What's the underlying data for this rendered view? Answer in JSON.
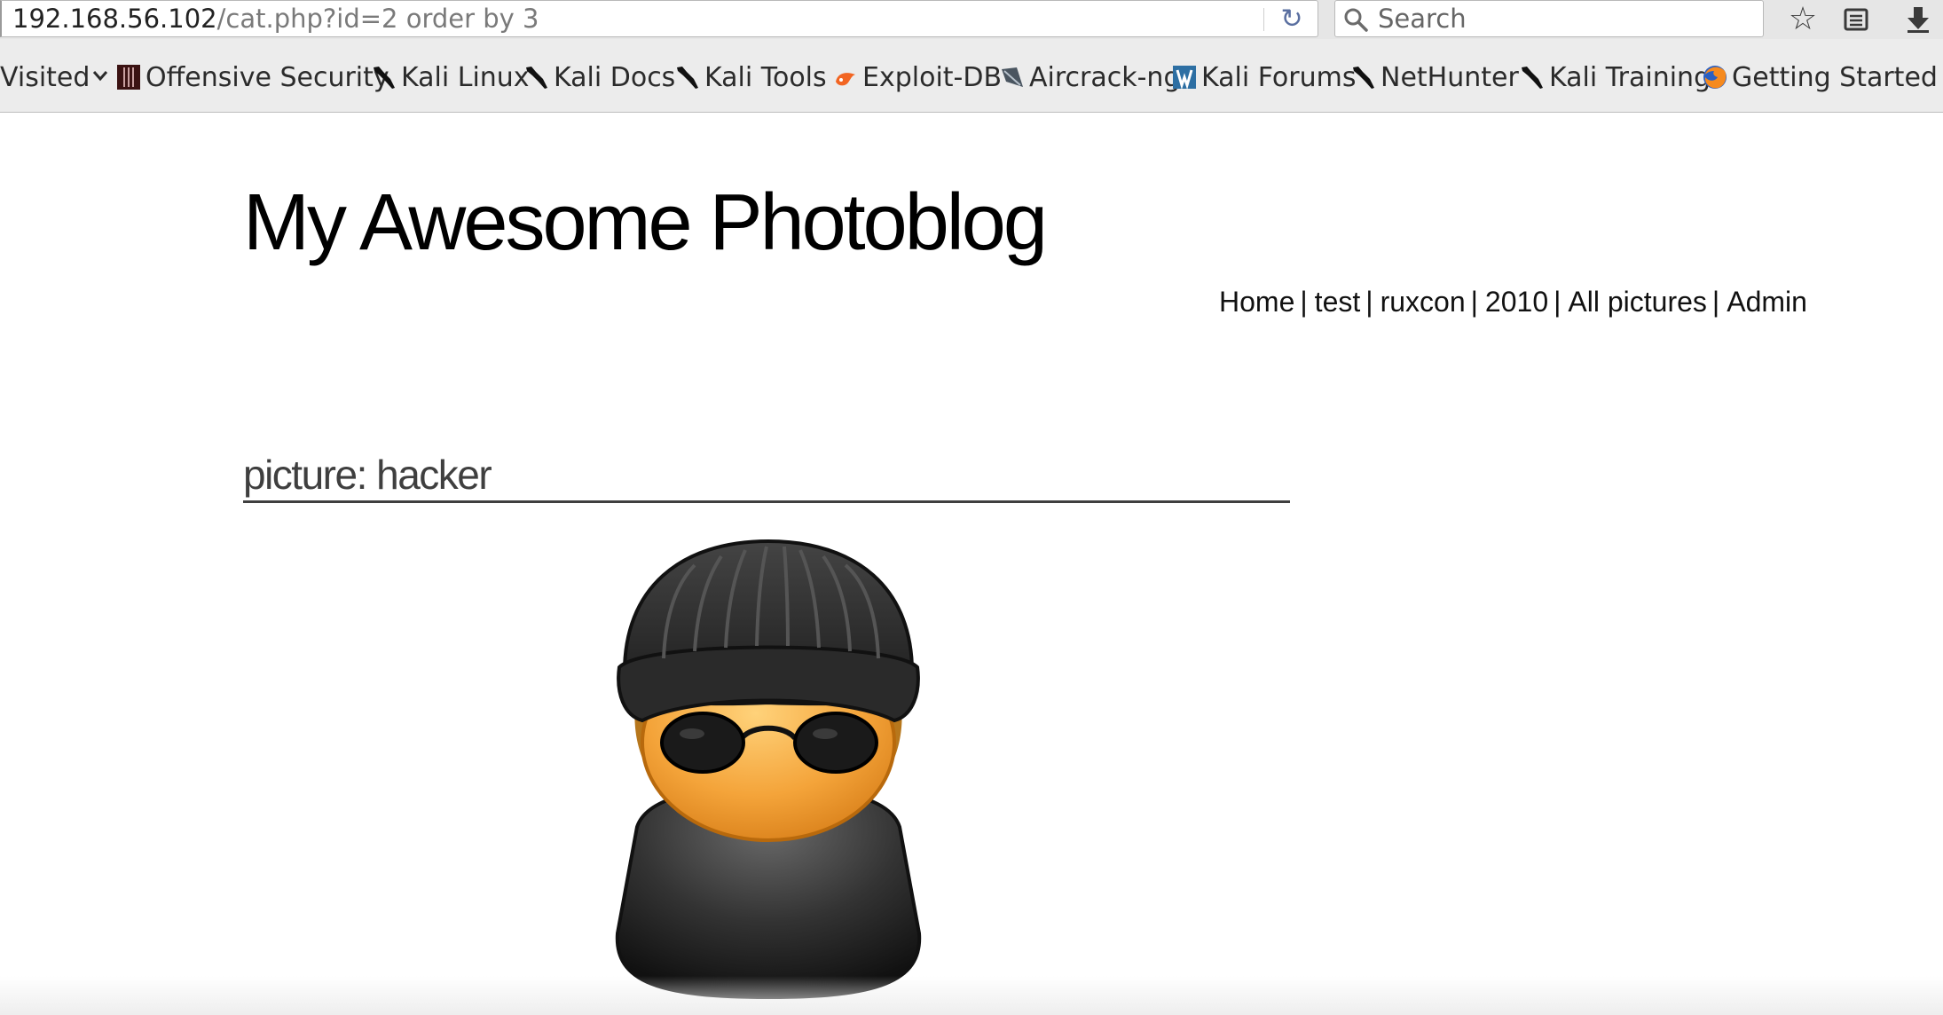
{
  "browser": {
    "url_host": "192.168.56.102",
    "url_path": "/cat.php?id=2 order by 3",
    "search_placeholder": "Search",
    "bookmarks": [
      {
        "label": "Visited",
        "icon": "chevron-down-icon"
      },
      {
        "label": "Offensive Security",
        "icon": "offsec-icon"
      },
      {
        "label": "Kali Linux",
        "icon": "kali-dragon-icon"
      },
      {
        "label": "Kali Docs",
        "icon": "kali-dragon-icon"
      },
      {
        "label": "Kali Tools",
        "icon": "kali-dragon-icon"
      },
      {
        "label": "Exploit-DB",
        "icon": "exploit-db-icon"
      },
      {
        "label": "Aircrack-ng",
        "icon": "aircrack-icon"
      },
      {
        "label": "Kali Forums",
        "icon": "kali-forums-icon"
      },
      {
        "label": "NetHunter",
        "icon": "kali-dragon-icon"
      },
      {
        "label": "Kali Training",
        "icon": "kali-dragon-icon"
      },
      {
        "label": "Getting Started",
        "icon": "firefox-icon"
      }
    ]
  },
  "page": {
    "site_title": "My Awesome Photoblog",
    "nav": [
      "Home",
      "test",
      "ruxcon",
      "2010",
      "All pictures",
      "Admin"
    ],
    "nav_separator": "|",
    "picture_heading": "picture: hacker",
    "image_icon": "hacker-avatar-icon"
  },
  "colors": {
    "chrome_bg": "#e6e6e6",
    "title": "#000000",
    "heading": "#3f3f3f"
  }
}
